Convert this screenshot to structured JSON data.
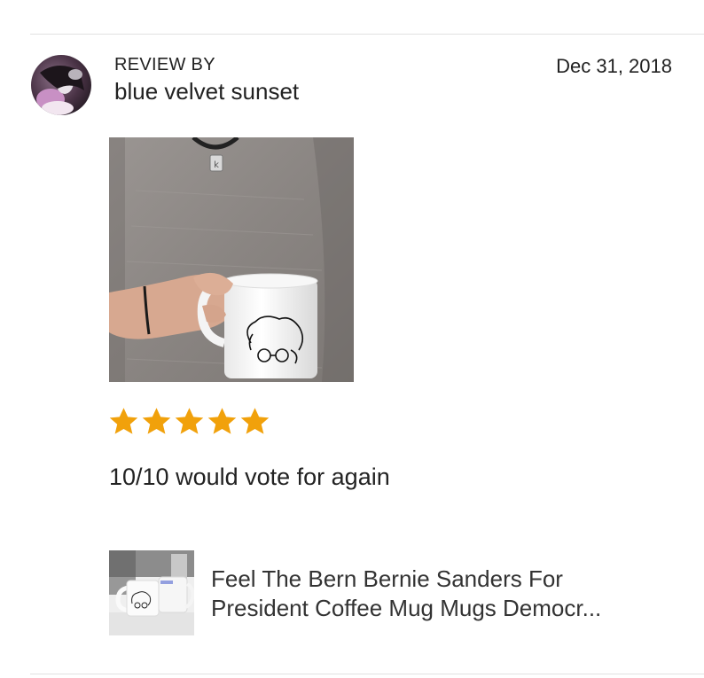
{
  "review": {
    "label": "REVIEW BY",
    "reviewer_name": "blue velvet sunset",
    "date": "Dec 31, 2018",
    "rating": 5,
    "rating_max": 5,
    "text": "10/10 would vote for again"
  },
  "product": {
    "title_line1": "Feel The Bern Bernie Sanders For",
    "title_line2": "President Coffee Mug Mugs Democr..."
  },
  "colors": {
    "star": "#f1a10b",
    "text": "#222222",
    "divider": "#e1e1e1"
  },
  "icons": {
    "star": "star-icon",
    "avatar": "avatar"
  }
}
